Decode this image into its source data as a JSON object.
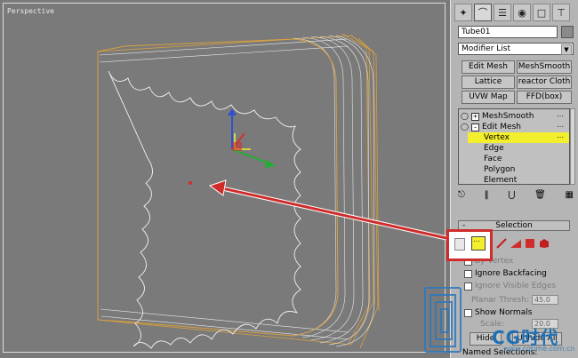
{
  "viewport": {
    "label": "Perspective"
  },
  "panel": {
    "tabs": [
      "create-icon",
      "modify-icon",
      "hierarchy-icon",
      "motion-icon",
      "display-icon",
      "utilities-icon"
    ],
    "object_name": "Tube01",
    "modifier_list": "Modifier List",
    "buttons": {
      "edit_mesh": "Edit Mesh",
      "meshsmooth": "MeshSmooth",
      "lattice": "Lattice",
      "reactor_cloth": "reactor Cloth",
      "uvw_map": "UVW Map",
      "ffd_box": "FFD(box)"
    },
    "stack": {
      "meshsmooth": "MeshSmooth",
      "edit_mesh": "Edit Mesh",
      "vertex": "Vertex",
      "edge": "Edge",
      "face": "Face",
      "polygon": "Polygon",
      "element": "Element"
    },
    "selection": {
      "header": "Selection",
      "collapse": "-",
      "by_vertex": "By Vertex",
      "ignore_backfacing": "Ignore Backfacing",
      "ignore_visible_edges": "Ignore Visible Edges",
      "planar_thresh_label": "Planar Thresh:",
      "planar_thresh_value": "45.0",
      "show_normals": "Show Normals",
      "scale_label": "Scale:",
      "scale_value": "20.0",
      "hide": "Hide",
      "unhide_all": "Unhide All",
      "named_selections": "Named Selections:"
    }
  },
  "watermark": {
    "logo": "CG时代",
    "url": "www.cgtime.com.cn"
  },
  "colors": {
    "viewport_bg": "#7a7a7a",
    "wire_orange": "#d8a040",
    "wire_white": "#f0f0f0",
    "selected_yellow": "#f3ef2c",
    "callout_red": "#d02c2c"
  }
}
